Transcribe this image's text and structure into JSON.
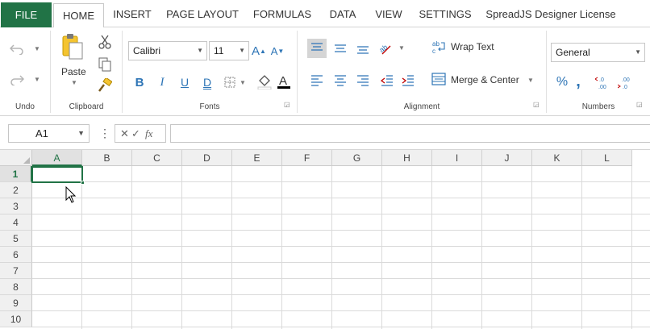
{
  "menu": {
    "tabs": [
      "FILE",
      "HOME",
      "INSERT",
      "PAGE LAYOUT",
      "FORMULAS",
      "DATA",
      "VIEW",
      "SETTINGS",
      "SpreadJS Designer License"
    ],
    "active_tab": "HOME"
  },
  "ribbon": {
    "undo_group": "Undo",
    "clipboard_group": "Clipboard",
    "paste_label": "Paste",
    "fonts_group": "Fonts",
    "font_name": "Calibri",
    "font_size": "11",
    "alignment_group": "Alignment",
    "wrap_text": "Wrap Text",
    "merge_center": "Merge & Center",
    "numbers_group": "Numbers",
    "number_format": "General"
  },
  "formula_bar": {
    "name_box": "A1",
    "formula": ""
  },
  "grid": {
    "columns": [
      "A",
      "B",
      "C",
      "D",
      "E",
      "F",
      "G",
      "H",
      "I",
      "J",
      "K",
      "L"
    ],
    "rows": [
      "1",
      "2",
      "3",
      "4",
      "5",
      "6",
      "7",
      "8",
      "9",
      "10"
    ],
    "selected_cell": "A1"
  },
  "colors": {
    "accent": "#217346",
    "icon_blue": "#2e75b6"
  },
  "icons": [
    "undo-icon",
    "redo-icon",
    "paste-icon",
    "cut-icon",
    "copy-icon",
    "format-painter-icon",
    "increase-font-icon",
    "decrease-font-icon",
    "bold-icon",
    "italic-icon",
    "underline-icon",
    "double-underline-icon",
    "border-icon",
    "fill-color-icon",
    "font-color-icon",
    "align-top-icon",
    "align-middle-icon",
    "align-bottom-icon",
    "orientation-icon",
    "align-left-icon",
    "align-center-icon",
    "align-right-icon",
    "decrease-indent-icon",
    "increase-indent-icon",
    "wrap-text-icon",
    "merge-center-icon",
    "percent-icon",
    "comma-icon",
    "increase-decimal-icon",
    "decrease-decimal-icon",
    "cancel-icon",
    "enter-icon",
    "fx-icon"
  ]
}
